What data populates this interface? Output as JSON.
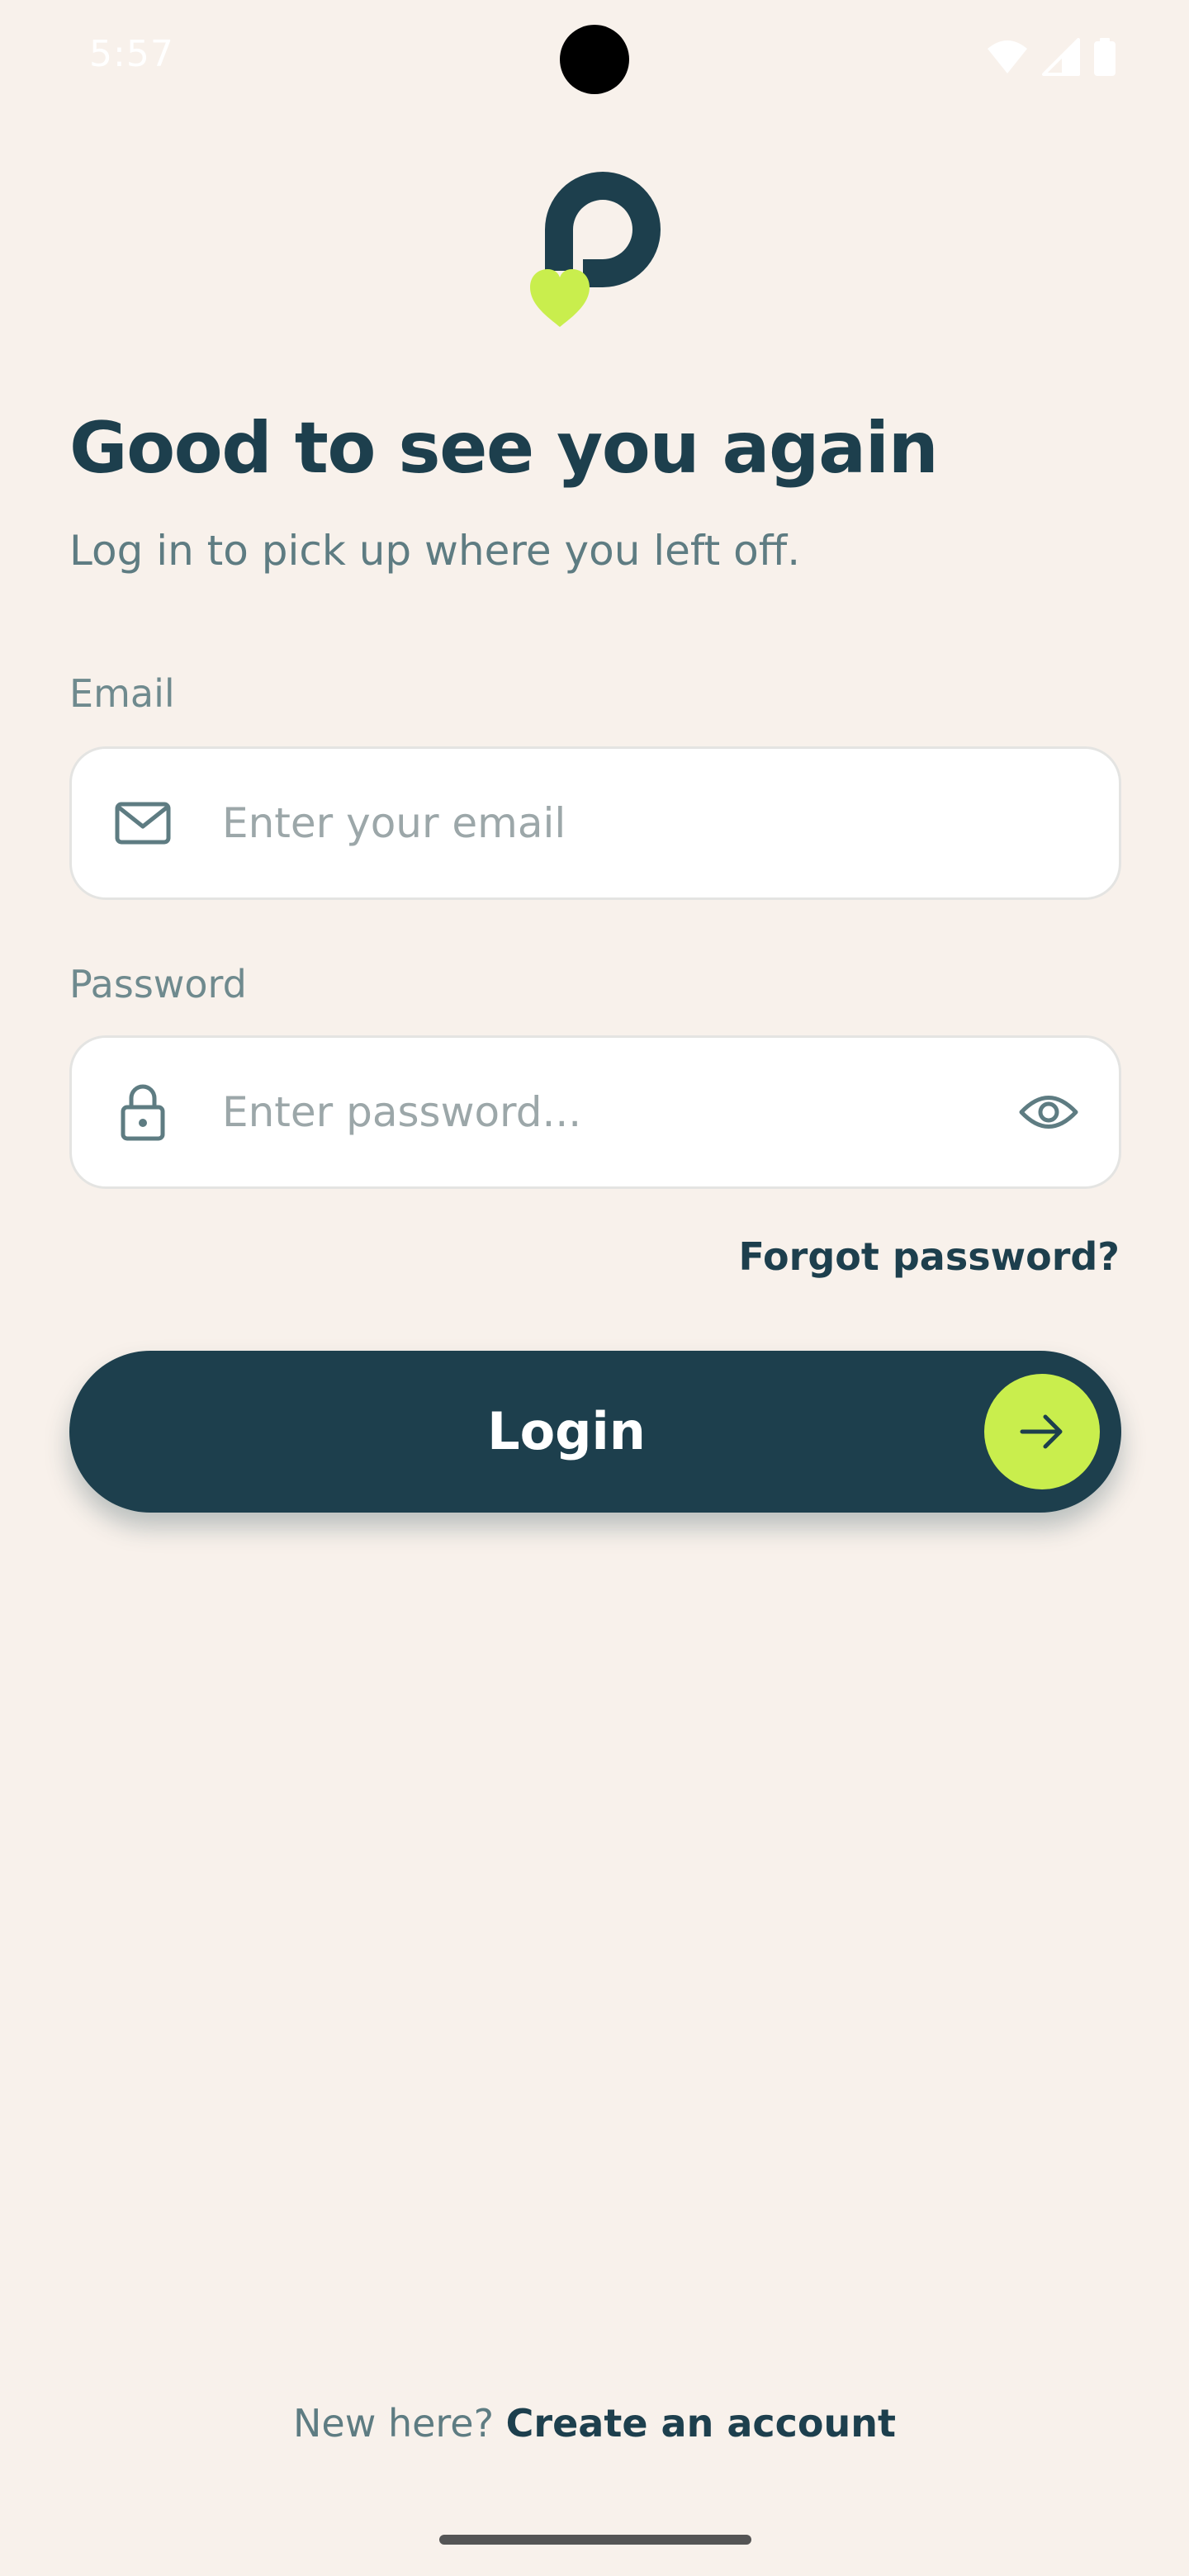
{
  "status_bar": {
    "time": "5:57",
    "icons": [
      "wifi-icon",
      "signal-icon",
      "battery-icon"
    ]
  },
  "logo": {
    "icon": "app-logo",
    "colors": {
      "primary": "#1D3F4D",
      "accent": "#C9EE4D"
    }
  },
  "header": {
    "title": "Good to see you again",
    "subtitle": "Log in to pick up where you left off."
  },
  "form": {
    "email": {
      "label": "Email",
      "placeholder": "Enter your email",
      "value": "",
      "icon": "mail-icon"
    },
    "password": {
      "label": "Password",
      "placeholder": "Enter password...",
      "value": "",
      "icon": "lock-icon",
      "toggle_icon": "eye-icon"
    },
    "forgot_label": "Forgot password?",
    "login_label": "Login",
    "login_icon": "arrow-right-icon"
  },
  "footer": {
    "prompt": "New here?",
    "link_label": "Create an account"
  },
  "colors": {
    "background": "#F8F1EB",
    "brand_dark": "#1D3F4D",
    "brand_lime": "#C9EE4D",
    "muted_text": "#5E7C82"
  }
}
